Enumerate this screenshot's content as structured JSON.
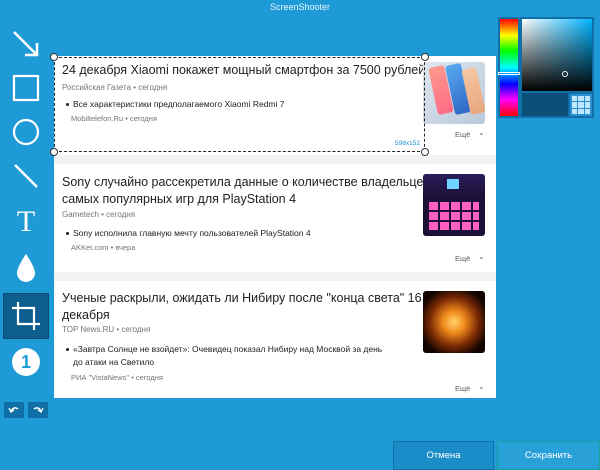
{
  "window": {
    "title": "ScreenShooter"
  },
  "tools": [
    {
      "name": "arrow-tool"
    },
    {
      "name": "rectangle-tool"
    },
    {
      "name": "ellipse-tool"
    },
    {
      "name": "line-tool"
    },
    {
      "name": "text-tool",
      "label": "T"
    },
    {
      "name": "blur-tool"
    },
    {
      "name": "crop-tool",
      "active": true
    },
    {
      "name": "number-tool",
      "label": "1"
    }
  ],
  "history": {
    "undo": "undo",
    "redo": "redo"
  },
  "selection": {
    "size": "598x152"
  },
  "news": [
    {
      "headline": "24 декабря Xiaomi покажет мощный смартфон за 7500 рублей",
      "source": "Российская Газета",
      "time": "сегодня",
      "sub_title": "Все характеристики предполагаемого Xiaomi Redmi 7",
      "sub_source": "Mobiltelefon.Ru",
      "sub_time": "сегодня",
      "more": "Ещё"
    },
    {
      "headline_line1": "Sony случайно рассекретила данные о количестве владельцев",
      "headline_line2": "самых популярных игр для PlayStation 4",
      "source": "Gametech",
      "time": "сегодня",
      "sub_title": "Sony исполнила главную мечту пользователей PlayStation 4",
      "sub_source": "AKKet.com",
      "sub_time": "вчера",
      "more": "Ещё"
    },
    {
      "headline_line1": "Ученые раскрыли, ожидать ли Нибиру после \"конца света\" 16",
      "headline_line2": "декабря",
      "source": "TOP News.RU",
      "time": "сегодня",
      "sub_title_line1": "«Завтра Солнце не взойдет»: Очевидец показал Нибиру над Москвой за день",
      "sub_title_line2": "до атаки на Светило",
      "sub_source": "РИА \"VistaNews\"",
      "sub_time": "сегодня",
      "more": "Ещё"
    }
  ],
  "palette": {
    "selected_color": "#0c4f79",
    "hue_color": "#00b4ff"
  },
  "buttons": {
    "cancel": "Отмена",
    "save": "Сохранить"
  }
}
